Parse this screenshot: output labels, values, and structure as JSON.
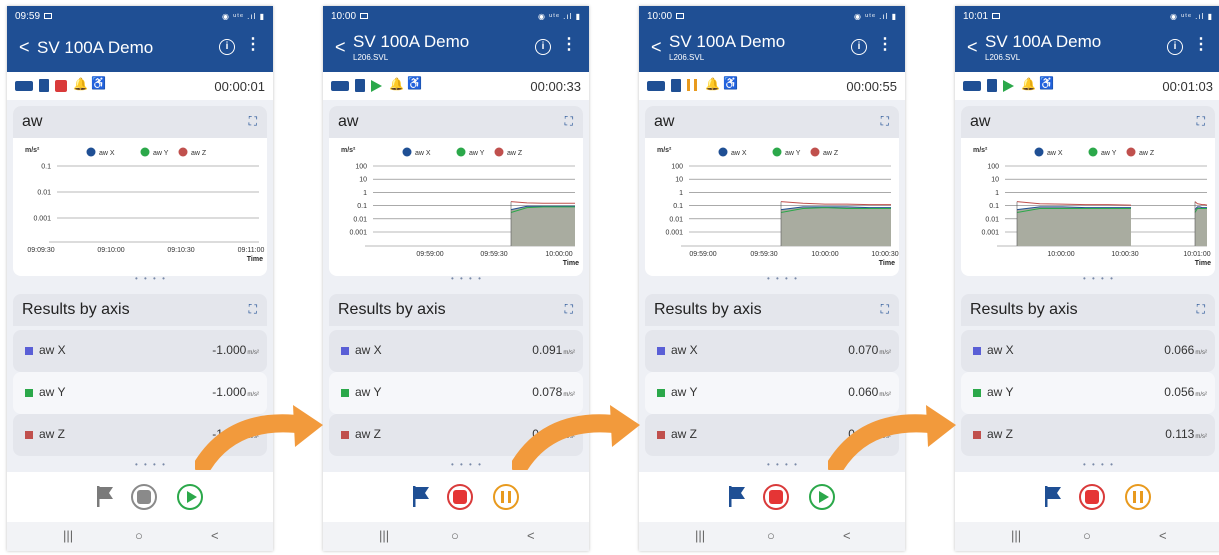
{
  "app": {
    "title": "SV 100A Demo",
    "subtitle": "L206.SVL",
    "back_glyph": "<",
    "info_glyph": "i",
    "menu_glyph": "⋮"
  },
  "chart_title": "aw",
  "results_title": "Results by axis",
  "legend": [
    "aw X",
    "aw Y",
    "aw Z"
  ],
  "y_unit": "m/s²",
  "x_unit": "Time",
  "colors": {
    "aw X": "#1f4f94",
    "aw Y": "#2ba84a",
    "aw Z": "#c0504d",
    "swatch_x": "#5a5fd6",
    "swatch_y": "#2ba84a",
    "swatch_z": "#c0504d",
    "accent": "#1f4f94"
  },
  "nav": {
    "recent": "|||",
    "home": "○",
    "back": "<"
  },
  "page_dots": {
    "chart": "• • • •",
    "results": "• • • •"
  },
  "phones": [
    {
      "clock": "09:59",
      "signal": "◉ ᵘᵗᵉ .ıl ▮",
      "subtitle": "",
      "record_state": "stopped",
      "elapsed": "00:00:01",
      "results": [
        {
          "label": "aw X",
          "value": "-1.000",
          "unit": "m/s²"
        },
        {
          "label": "aw Y",
          "value": "-1.000",
          "unit": "m/s²"
        },
        {
          "label": "aw Z",
          "value": "-1.000",
          "unit": "m/s²"
        }
      ],
      "controls": [
        "flag-inactive",
        "stop-inactive",
        "play"
      ],
      "chart_data": {
        "type": "area",
        "y_ticks": [
          "0.1",
          "0.01",
          "0.001"
        ],
        "x_ticks": [
          "09:09:30",
          "09:10:00",
          "09:10:30",
          "09:11:00"
        ],
        "ylabel": "m/s²",
        "xlabel": "Time",
        "series": []
      }
    },
    {
      "clock": "10:00",
      "signal": "◉ ᵘᵗᵉ .ıl ▮",
      "subtitle": "L206.SVL",
      "record_state": "recording",
      "elapsed": "00:00:33",
      "results": [
        {
          "label": "aw X",
          "value": "0.091",
          "unit": "m/s²"
        },
        {
          "label": "aw Y",
          "value": "0.078",
          "unit": "m/s²"
        },
        {
          "label": "aw Z",
          "value": "0.157",
          "unit": "m/s²"
        }
      ],
      "controls": [
        "flag",
        "stop",
        "pause"
      ],
      "chart_data": {
        "type": "area",
        "y_ticks": [
          "100",
          "10",
          "1",
          "0.1",
          "0.01",
          "0.001"
        ],
        "x_ticks": [
          "09:59:00",
          "09:59:30",
          "10:00:00"
        ],
        "ylabel": "m/s²",
        "xlabel": "Time",
        "series": [
          {
            "name": "aw X",
            "values": [
              0.05,
              0.09,
              0.09,
              0.09,
              0.09
            ]
          },
          {
            "name": "aw Y",
            "values": [
              0.03,
              0.07,
              0.08,
              0.08,
              0.08
            ]
          },
          {
            "name": "aw Z",
            "values": [
              0.2,
              0.16,
              0.15,
              0.15,
              0.15
            ]
          }
        ]
      }
    },
    {
      "clock": "10:00",
      "signal": "◉ ᵘᵗᵉ .ıl ▮",
      "subtitle": "L206.SVL",
      "record_state": "paused",
      "elapsed": "00:00:55",
      "results": [
        {
          "label": "aw X",
          "value": "0.070",
          "unit": "m/s²"
        },
        {
          "label": "aw Y",
          "value": "0.060",
          "unit": "m/s²"
        },
        {
          "label": "aw Z",
          "value": "0.120",
          "unit": "m/s²"
        }
      ],
      "controls": [
        "flag",
        "stop",
        "play"
      ],
      "chart_data": {
        "type": "area",
        "y_ticks": [
          "100",
          "10",
          "1",
          "0.1",
          "0.01",
          "0.001"
        ],
        "x_ticks": [
          "09:59:00",
          "09:59:30",
          "10:00:00",
          "10:00:30"
        ],
        "ylabel": "m/s²",
        "xlabel": "Time",
        "series": [
          {
            "name": "aw X",
            "values": [
              0.05,
              0.08,
              0.08,
              0.08,
              0.07,
              0.07
            ]
          },
          {
            "name": "aw Y",
            "values": [
              0.03,
              0.06,
              0.07,
              0.06,
              0.06,
              0.06
            ]
          },
          {
            "name": "aw Z",
            "values": [
              0.2,
              0.15,
              0.13,
              0.13,
              0.12,
              0.12
            ]
          }
        ]
      }
    },
    {
      "clock": "10:01",
      "signal": "◉ ᵘᵗᵉ .ıl ▮",
      "subtitle": "L206.SVL",
      "record_state": "recording",
      "elapsed": "00:01:03",
      "results": [
        {
          "label": "aw X",
          "value": "0.066",
          "unit": "m/s²"
        },
        {
          "label": "aw Y",
          "value": "0.056",
          "unit": "m/s²"
        },
        {
          "label": "aw Z",
          "value": "0.113",
          "unit": "m/s²"
        }
      ],
      "controls": [
        "flag",
        "stop",
        "pause"
      ],
      "chart_data": {
        "type": "area",
        "y_ticks": [
          "100",
          "10",
          "1",
          "0.1",
          "0.01",
          "0.001"
        ],
        "x_ticks": [
          "10:00:00",
          "10:00:30",
          "10:01:00"
        ],
        "ylabel": "m/s²",
        "xlabel": "Time",
        "series": [
          {
            "name": "aw X",
            "values": [
              0.05,
              0.08,
              0.08,
              0.07,
              0.07,
              0.07
            ]
          },
          {
            "name": "aw Y",
            "values": [
              0.03,
              0.06,
              0.06,
              0.06,
              0.06,
              0.06
            ]
          },
          {
            "name": "aw Z",
            "values": [
              0.2,
              0.14,
              0.13,
              0.12,
              0.12,
              0.11
            ]
          }
        ]
      }
    }
  ]
}
